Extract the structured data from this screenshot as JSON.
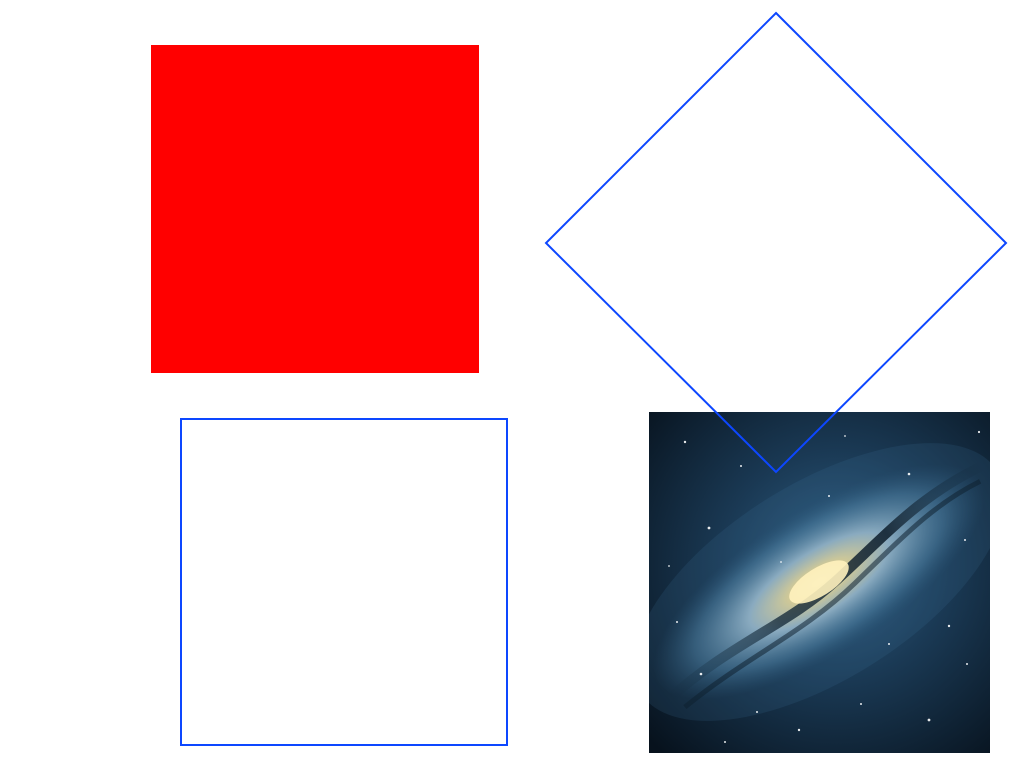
{
  "colors": {
    "background": "#ffffff",
    "filled_square": "#ff0000",
    "outline_stroke": "#0d47ff",
    "galaxy_space": "#0b1a2a",
    "galaxy_arm": "#3f6f93",
    "galaxy_core": "#f3e6a6"
  },
  "shapes": {
    "filled_square": {
      "kind": "square",
      "fill": "red"
    },
    "outline_square": {
      "kind": "square",
      "fill": "none",
      "stroke": "blue"
    },
    "outline_diamond": {
      "kind": "diamond",
      "fill": "none",
      "stroke": "blue"
    },
    "galaxy_picture": {
      "kind": "image",
      "subject": "spiral galaxy"
    }
  }
}
